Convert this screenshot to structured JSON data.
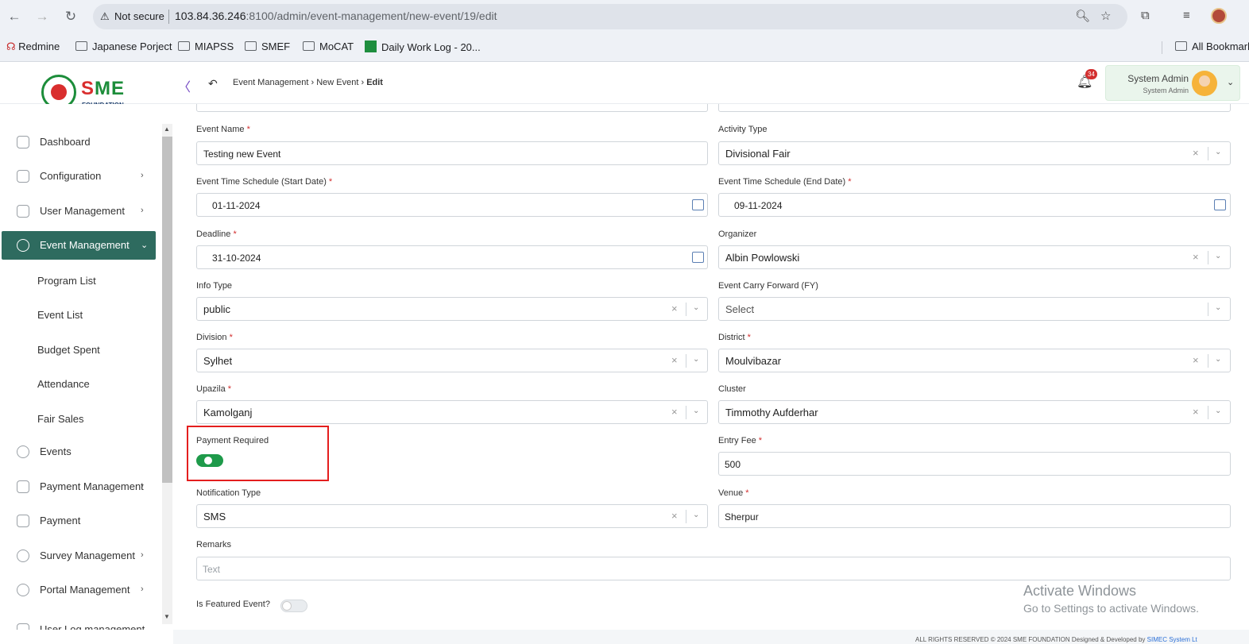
{
  "browser": {
    "not_secure": "Not secure",
    "url_host": "103.84.36.246",
    "url_path": ":8100/admin/event-management/new-event/19/edit",
    "bookmarks": [
      "Redmine",
      "Japanese Porject",
      "MIAPSS",
      "SMEF",
      "MoCAT",
      "Daily Work Log - 20...",
      "All Bookmarks"
    ]
  },
  "header": {
    "logo_text_left": "S",
    "logo_text_right": "ME",
    "logo_sub": "FOUNDATION",
    "breadcrumb": [
      "Event Management",
      "New Event",
      "Edit"
    ],
    "notification_count": "34",
    "user_name": "System Admin",
    "user_role": "System Admin"
  },
  "sidebar": {
    "items": [
      {
        "label": "Dashboard"
      },
      {
        "label": "Configuration"
      },
      {
        "label": "User Management"
      },
      {
        "label": "Event Management"
      },
      {
        "label": "Events"
      },
      {
        "label": "Payment Management"
      },
      {
        "label": "Payment"
      },
      {
        "label": "Survey Management"
      },
      {
        "label": "Portal Management"
      },
      {
        "label": "User Log management"
      }
    ],
    "sub_items": [
      "Program List",
      "Event List",
      "Budget Spent",
      "Attendance",
      "Fair Sales"
    ]
  },
  "form": {
    "event_name": {
      "label": "Event Name",
      "req": "*",
      "value": "Testing new Event"
    },
    "activity_type": {
      "label": "Activity Type",
      "value": "Divisional Fair"
    },
    "start_date": {
      "label": "Event Time Schedule (Start Date)",
      "req": "*",
      "value": "01-11-2024"
    },
    "end_date": {
      "label": "Event Time Schedule (End Date)",
      "req": "*",
      "value": "09-11-2024"
    },
    "deadline": {
      "label": "Deadline",
      "req": "*",
      "value": "31-10-2024"
    },
    "organizer": {
      "label": "Organizer",
      "value": "Albin Powlowski"
    },
    "info_type": {
      "label": "Info Type",
      "value": "public"
    },
    "carry_forward": {
      "label": "Event Carry Forward (FY)",
      "placeholder": "Select"
    },
    "division": {
      "label": "Division",
      "req": "*",
      "value": "Sylhet"
    },
    "district": {
      "label": "District",
      "req": "*",
      "value": "Moulvibazar"
    },
    "upazila": {
      "label": "Upazila",
      "req": "*",
      "value": "Kamolganj"
    },
    "cluster": {
      "label": "Cluster",
      "value": "Timmothy Aufderhar"
    },
    "payment_required": {
      "label": "Payment Required",
      "on": true
    },
    "entry_fee": {
      "label": "Entry Fee",
      "req": "*",
      "value": "500"
    },
    "notification_type": {
      "label": "Notification Type",
      "value": "SMS"
    },
    "venue": {
      "label": "Venue",
      "req": "*",
      "value": "Sherpur"
    },
    "remarks": {
      "label": "Remarks",
      "placeholder": "Text"
    },
    "is_featured": {
      "label": "Is Featured Event?",
      "on": false
    }
  },
  "watermark": {
    "line1": "Activate Windows",
    "line2": "Go to Settings to activate Windows."
  },
  "footer": {
    "text": "ALL RIGHTS RESERVED © 2024 SME FOUNDATION   Designed & Developed by",
    "link": "SIMEC System Lt"
  },
  "colors": {
    "accent": "#2e6b5f",
    "toggle_on": "#1e9a4a",
    "highlight": "#e41e1e"
  }
}
